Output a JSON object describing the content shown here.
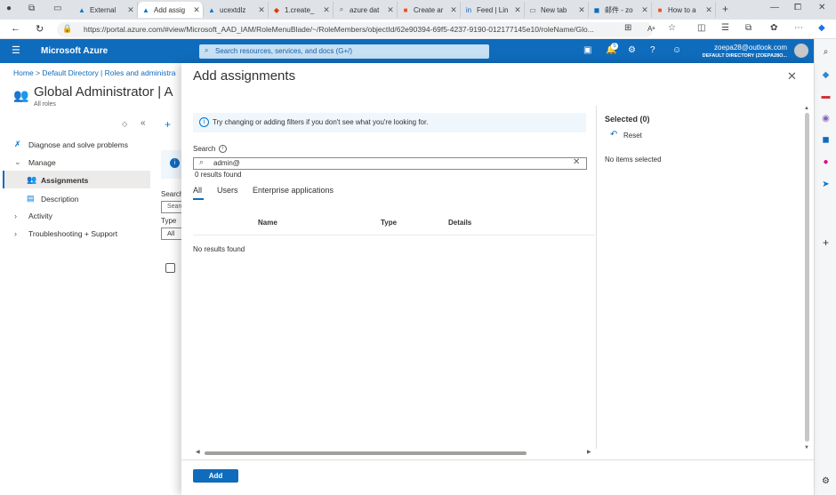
{
  "browser": {
    "tabs": [
      {
        "title": "External",
        "icon": "azure"
      },
      {
        "title": "Add assig",
        "icon": "azure",
        "active": true
      },
      {
        "title": "ucextdlz",
        "icon": "azure"
      },
      {
        "title": "1.create_",
        "icon": "office"
      },
      {
        "title": "azure dat",
        "icon": "search"
      },
      {
        "title": "Create ar",
        "icon": "microsoft"
      },
      {
        "title": "Feed | Lin",
        "icon": "linkedin"
      },
      {
        "title": "New tab",
        "icon": "newtab"
      },
      {
        "title": "邮件 - zo",
        "icon": "outlook"
      },
      {
        "title": "How to a",
        "icon": "microsoft"
      }
    ],
    "url": "https://portal.azure.com/#view/Microsoft_AAD_IAM/RoleMenuBlade/~/RoleMembers/objectId/62e90394-69f5-4237-9190-012177145e10/roleName/Glo..."
  },
  "azure": {
    "brand": "Microsoft Azure",
    "search_placeholder": "Search resources, services, and docs (G+/)",
    "notification_count": "5",
    "account_email": "zoepa28@outlook.com",
    "account_directory": "DEFAULT DIRECTORY (ZOEPA28O..."
  },
  "blade": {
    "breadcrumb": [
      "Home",
      "Default Directory | Roles and administra"
    ],
    "title": "Global Administrator | A",
    "subtitle": "All roles",
    "nav": [
      {
        "label": "Diagnose and solve problems",
        "icon": "wrench-icon"
      },
      {
        "label": "Manage",
        "icon": "chevron-down-icon"
      },
      {
        "label": "Assignments",
        "icon": "people-icon",
        "selected": true
      },
      {
        "label": "Description",
        "icon": "document-icon"
      },
      {
        "label": "Activity",
        "icon": "chevron-right-icon"
      },
      {
        "label": "Troubleshooting + Support",
        "icon": "chevron-right-icon"
      }
    ],
    "search_partial": "Search",
    "search_input_partial": "Searc",
    "type_label": "Type",
    "type_value": "All"
  },
  "panel": {
    "title": "Add assignments",
    "info_text": "Try changing or adding filters if you don't see what you're looking for.",
    "search_label": "Search",
    "search_value": "admin@",
    "results_count": "0 results found",
    "tabs": [
      "All",
      "Users",
      "Enterprise applications"
    ],
    "columns": [
      "Name",
      "Type",
      "Details"
    ],
    "no_results": "No results found",
    "selected_title": "Selected (0)",
    "reset_label": "Reset",
    "no_items": "No items selected",
    "add_button": "Add"
  },
  "colors": {
    "accent": "#0f6cbd",
    "info_bg": "#eff6fc"
  }
}
